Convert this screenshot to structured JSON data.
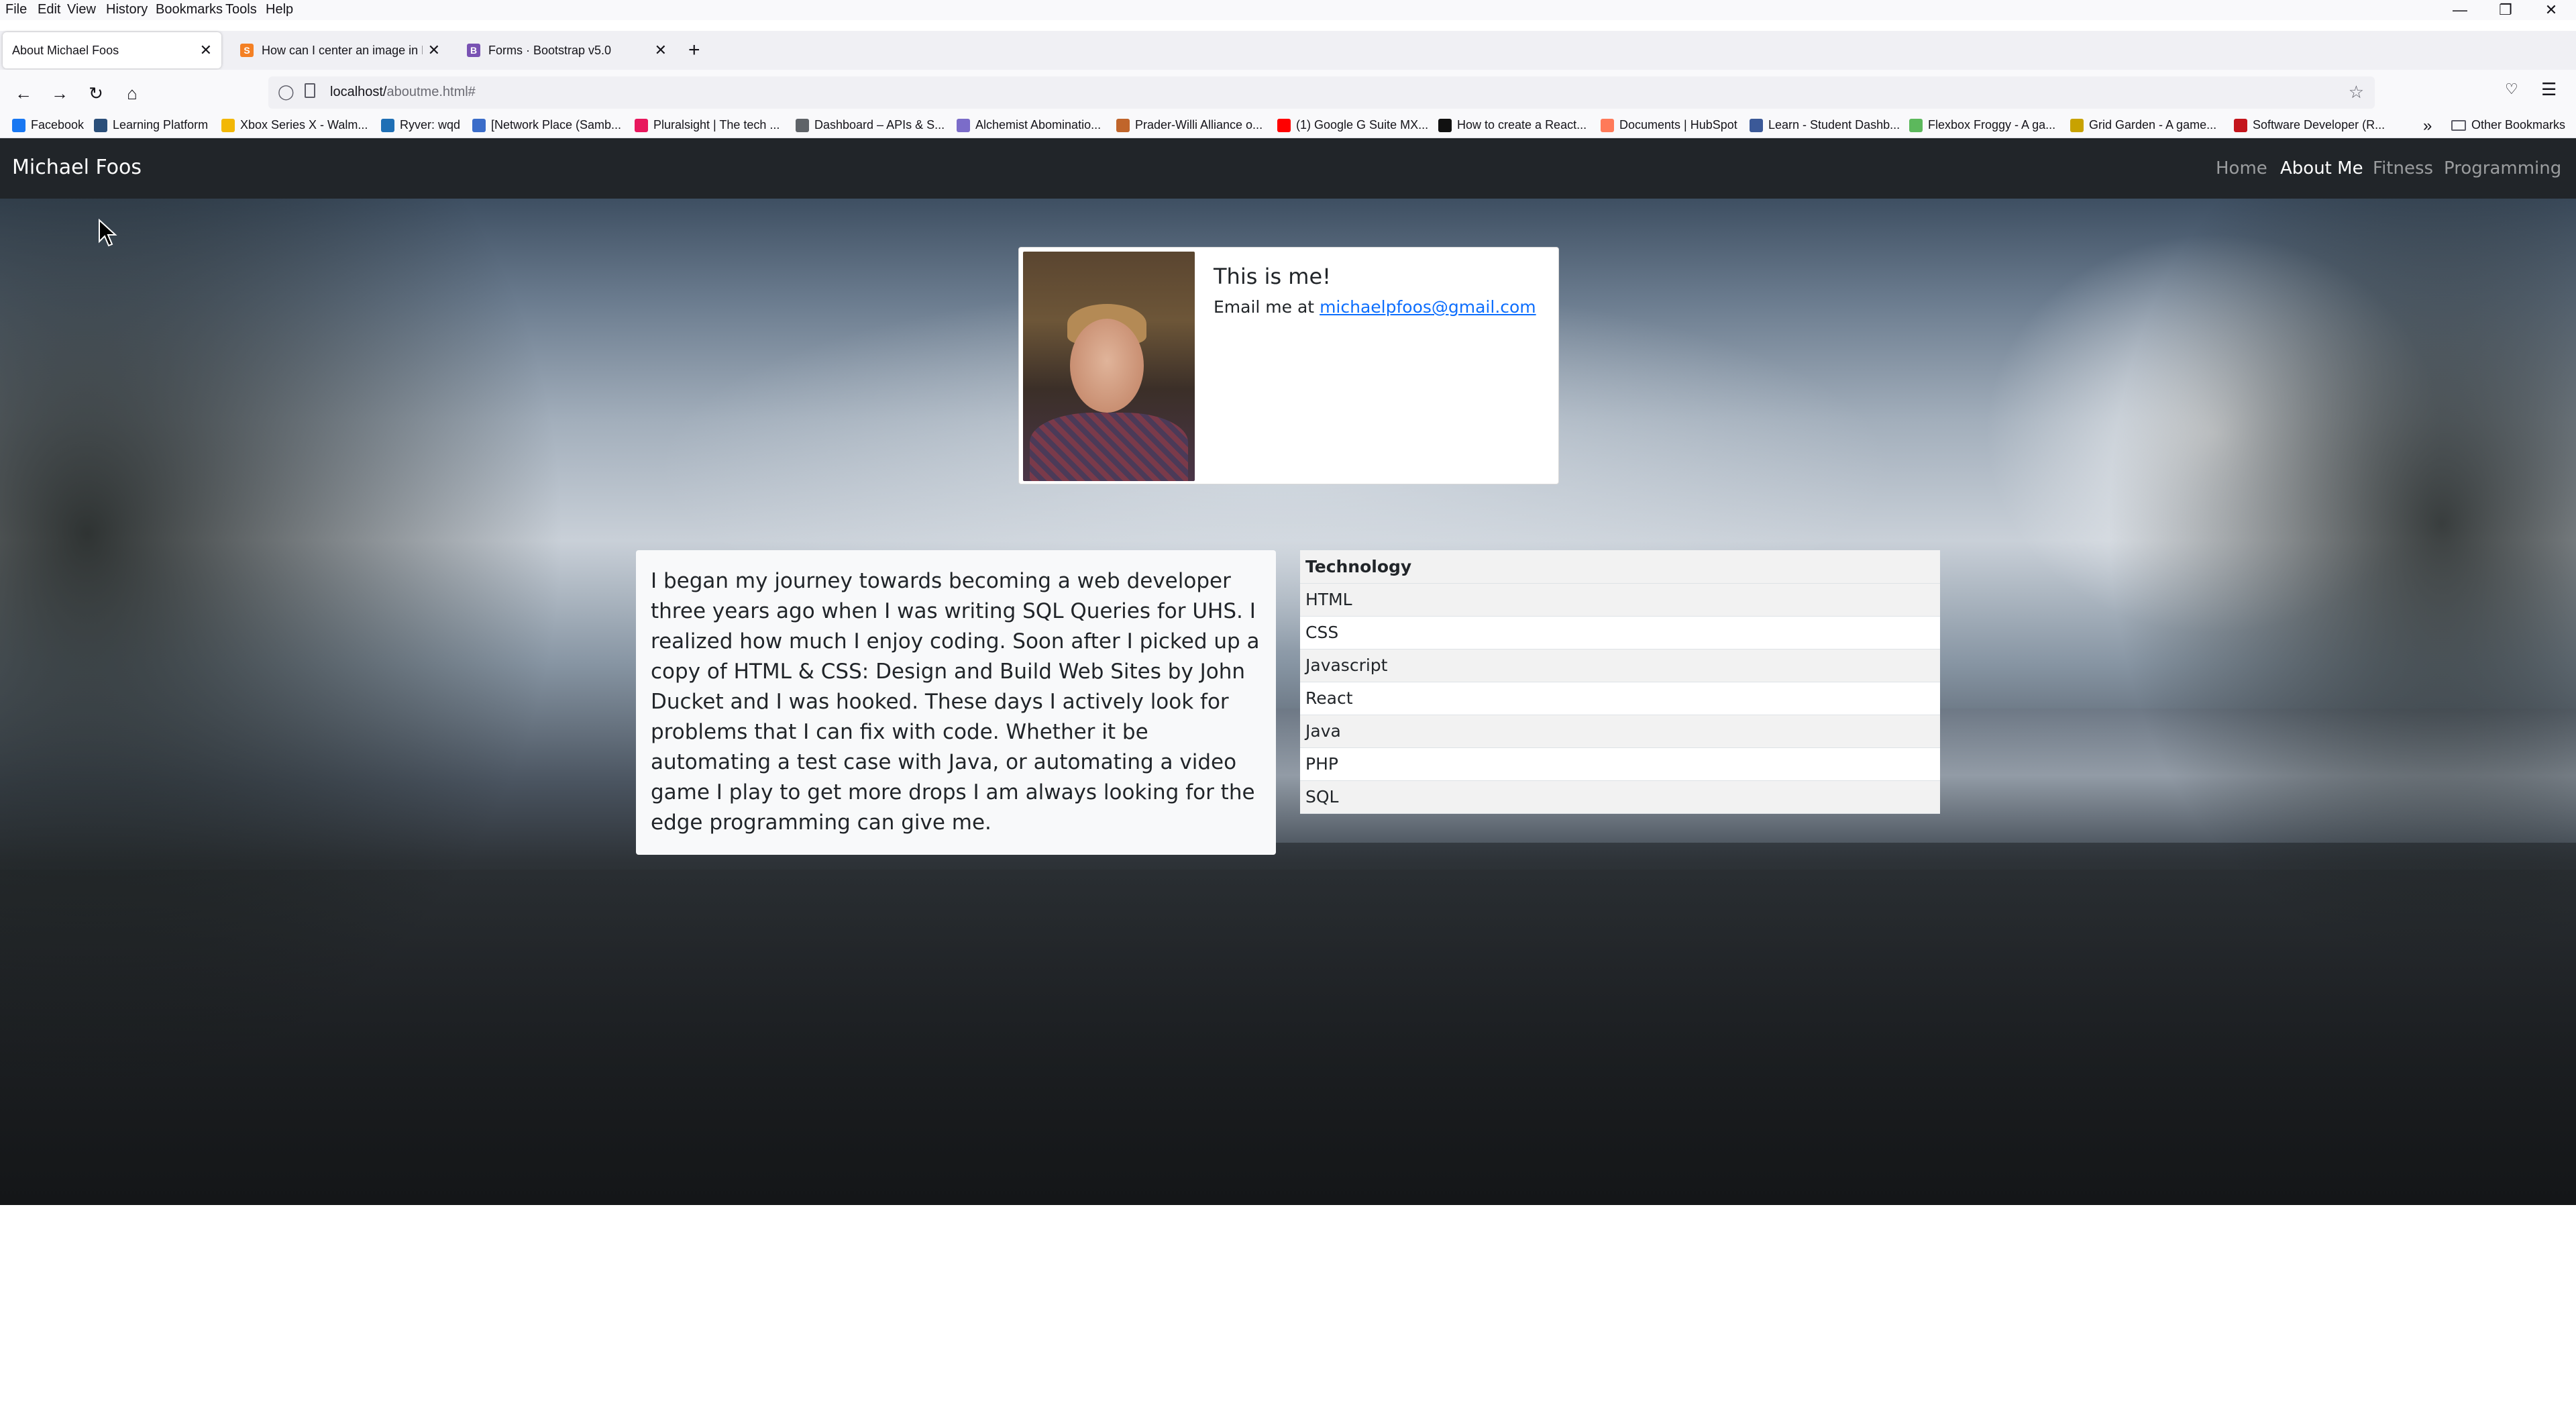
{
  "menubar": {
    "items": [
      "File",
      "Edit",
      "View",
      "History",
      "Bookmarks",
      "Tools",
      "Help"
    ]
  },
  "tabs": [
    {
      "title": "About Michael Foos",
      "active": true
    },
    {
      "title": "How can I center an image in Bo",
      "active": false
    },
    {
      "title": "Forms · Bootstrap v5.0",
      "active": false
    }
  ],
  "address_bar": {
    "host": "localhost/",
    "path": "aboutme.html#"
  },
  "bookmarks": [
    {
      "label": "Facebook",
      "icon": "facebook-icon",
      "color": "#1877f2"
    },
    {
      "label": "Learning Platform",
      "icon": "learning-platform-icon",
      "color": "#2b4f7a"
    },
    {
      "label": "Xbox Series X - Walm...",
      "icon": "walmart-icon",
      "color": "#f2b705"
    },
    {
      "label": "Ryver: wqd",
      "icon": "ryver-icon",
      "color": "#1f6fb5"
    },
    {
      "label": "[Network Place (Samb...",
      "icon": "network-icon",
      "color": "#3a6cc9"
    },
    {
      "label": "Pluralsight | The tech ...",
      "icon": "pluralsight-icon",
      "color": "#e8175d"
    },
    {
      "label": "Dashboard – APIs & S...",
      "icon": "google-cloud-icon",
      "color": "#5f6368"
    },
    {
      "label": "Alchemist Abominatio...",
      "icon": "alchemist-icon",
      "color": "#7b6cc9"
    },
    {
      "label": "Prader-Willi Alliance o...",
      "icon": "pwsa-icon",
      "color": "#c0652b"
    },
    {
      "label": "(1) Google G Suite MX...",
      "icon": "youtube-icon",
      "color": "#ff0000"
    },
    {
      "label": "How to create a React...",
      "icon": "react-article-icon",
      "color": "#111111"
    },
    {
      "label": "Documents | HubSpot",
      "icon": "hubspot-icon",
      "color": "#ff7a59"
    },
    {
      "label": "Learn - Student Dashb...",
      "icon": "learn-icon",
      "color": "#3b5998"
    },
    {
      "label": "Flexbox Froggy - A ga...",
      "icon": "froggy-icon",
      "color": "#5cb85c"
    },
    {
      "label": "Grid Garden - A game...",
      "icon": "grid-garden-icon",
      "color": "#c8a200"
    },
    {
      "label": "Software Developer (R...",
      "icon": "software-dev-icon",
      "color": "#c4151c"
    }
  ],
  "other_bookmarks": "Other Bookmarks",
  "site": {
    "brand": "Michael Foos",
    "nav": [
      {
        "label": "Home",
        "active": false
      },
      {
        "label": "About Me",
        "active": true
      },
      {
        "label": "Fitness",
        "active": false
      },
      {
        "label": "Programming",
        "active": false
      }
    ]
  },
  "profile": {
    "title": "This is me!",
    "email_prefix": "Email me at ",
    "email": "michaelpfoos@gmail.com"
  },
  "bio": "I began my journey towards becoming a web developer three years ago when I was writing SQL Queries for UHS. I realized how much I enjoy coding. Soon after I picked up a copy of HTML & CSS: Design and Build Web Sites by John Ducket and I was hooked. These days I actively look for problems that I can fix with code. Whether it be automating a test case with Java, or automating a video game I play to get more drops I am always looking for the edge programming can give me.",
  "tech_table": {
    "header": "Technology",
    "rows": [
      "HTML",
      "CSS",
      "Javascript",
      "React",
      "Java",
      "PHP",
      "SQL"
    ]
  },
  "colors": {
    "navbar_bg": "#212529",
    "link": "#0d6efd"
  }
}
